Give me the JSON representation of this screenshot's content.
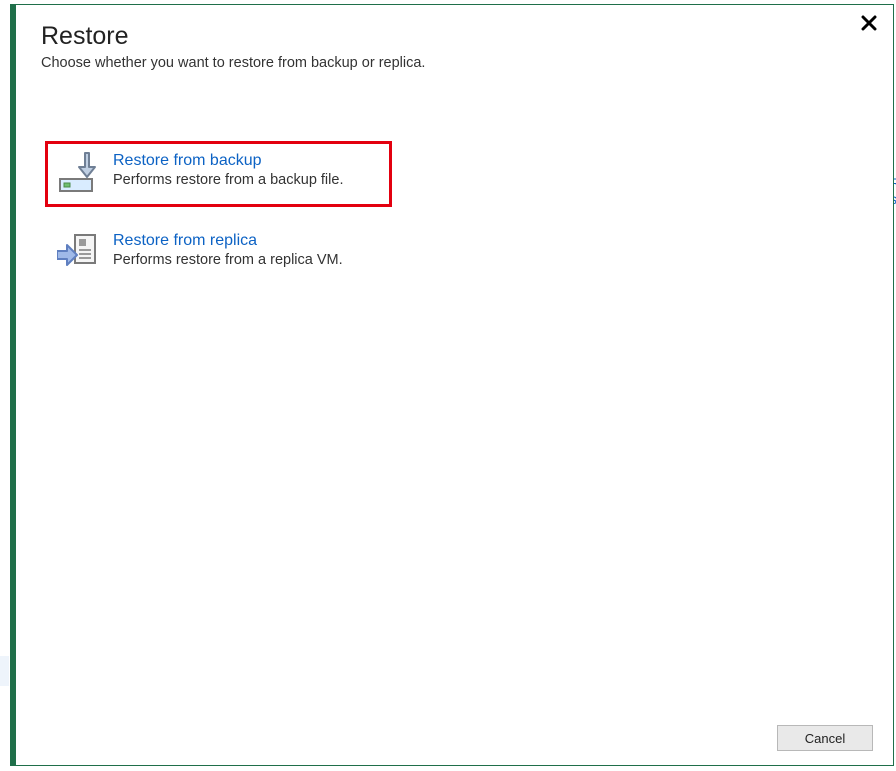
{
  "header": {
    "title": "Restore",
    "subtitle": "Choose whether you want to restore from backup or replica."
  },
  "options": [
    {
      "title": "Restore from backup",
      "desc": "Performs restore from a backup file.",
      "highlighted": true
    },
    {
      "title": "Restore from replica",
      "desc": "Performs restore from a replica VM.",
      "highlighted": false
    }
  ],
  "footer": {
    "cancel_label": "Cancel"
  },
  "decor": {
    "bg_right_text": "R\ns"
  }
}
